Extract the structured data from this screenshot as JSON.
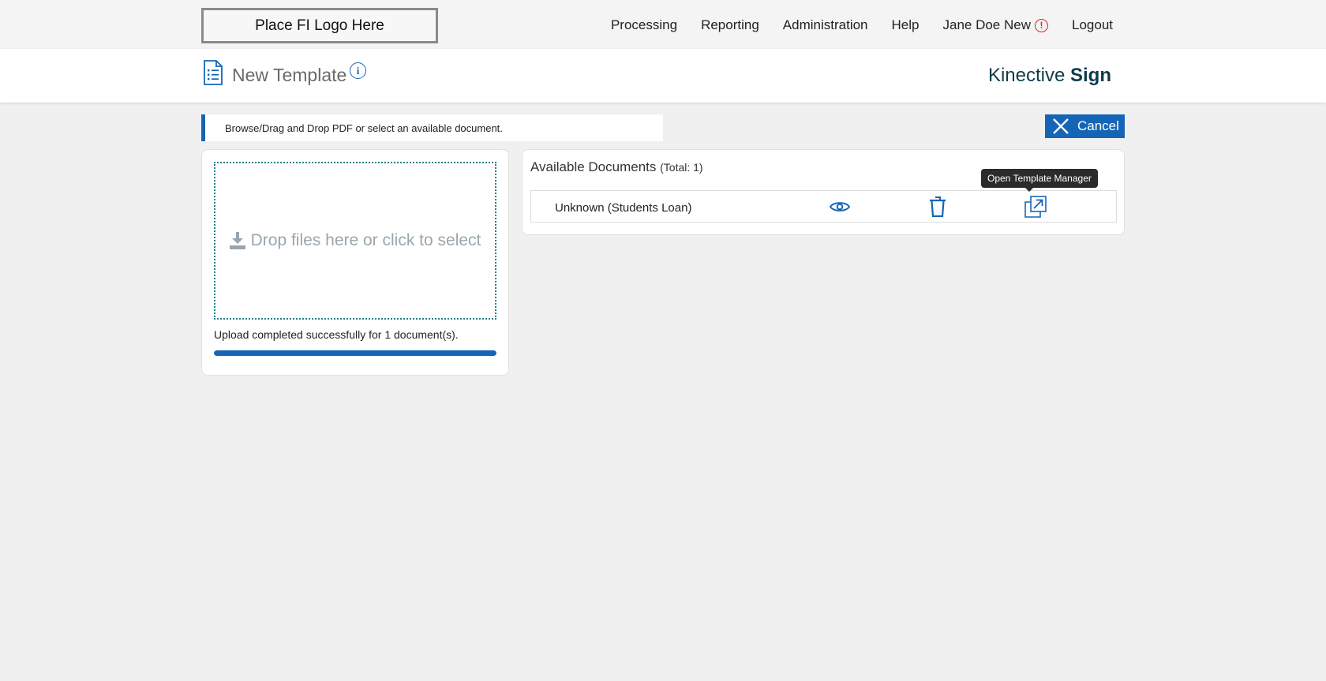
{
  "topbar": {
    "logo_text": "Place FI Logo Here",
    "nav": [
      {
        "label": "Processing"
      },
      {
        "label": "Reporting"
      },
      {
        "label": "Administration"
      },
      {
        "label": "Help"
      }
    ],
    "user_name": "Jane Doe New",
    "alert_glyph": "!",
    "logout_label": "Logout"
  },
  "header": {
    "title": "New Template",
    "info_glyph": "i",
    "brand_light": "Kinective",
    "brand_bold": "Sign"
  },
  "instruction": "Browse/Drag and Drop PDF or select an available document.",
  "cancel_label": "Cancel",
  "upload": {
    "drop_text": "Drop files here or click to select",
    "status_text": "Upload completed successfully for 1 document(s).",
    "progress_fraction": 1.0
  },
  "documents": {
    "title": "Available Documents",
    "total_text": "(Total: 1)",
    "rows": [
      {
        "name": "Unknown (Students Loan)"
      }
    ],
    "tooltip": "Open Template Manager"
  },
  "colors": {
    "accent": "#1565b7",
    "alert": "#e0232f",
    "brand": "#0d3b4a"
  }
}
